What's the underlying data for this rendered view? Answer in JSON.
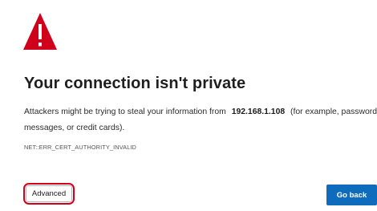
{
  "icons": {
    "warning": "warning-triangle-icon"
  },
  "colors": {
    "warning_red": "#d0021b",
    "primary_blue": "#0f6cbd",
    "highlight_outline": "#d0021b"
  },
  "main": {
    "title": "Your connection isn't private",
    "message_before": "Attackers might be trying to steal your information from",
    "host": "192.168.1.108",
    "message_after": "(for example, passwords, messages, or credit cards).",
    "error_code": "NET::ERR_CERT_AUTHORITY_INVALID"
  },
  "buttons": {
    "advanced_label": "Advanced",
    "go_back_label": "Go back"
  }
}
